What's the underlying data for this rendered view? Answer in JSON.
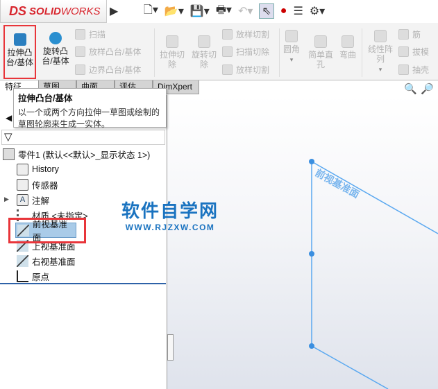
{
  "app": {
    "logo": "SOLIDWORKS",
    "logo_prefix": "DS",
    "logo_bold": "SOLID",
    "logo_light": "WORKS"
  },
  "toolbar": {
    "icons": [
      "new-icon",
      "open-icon",
      "save-icon",
      "print-icon",
      "undo-icon",
      "select-icon",
      "rebuild-icon",
      "file-properties-icon",
      "options-icon"
    ]
  },
  "ribbon": {
    "extrude": "拉伸凸\n台/基体",
    "revolve": "旋转凸\n台/基体",
    "sweep": "扫描",
    "loft": "放样凸台/基体",
    "boundary": "边界凸台/基体",
    "extrude_cut": "拉伸切\n除",
    "revolve_cut": "旋转切\n除",
    "loft_cut": "放样切割",
    "sweep_cut": "扫描切除",
    "boundary_cut": "放样切割",
    "fillet": "圆角",
    "hole": "简单直\n孔",
    "flex": "弯曲",
    "pattern": "线性阵\n列",
    "rib": "筋",
    "draft": "拔模",
    "shell": "抽壳"
  },
  "tabs": [
    "特征",
    "草图",
    "曲面",
    "评估",
    "DimXpert"
  ],
  "tooltip": {
    "title": "拉伸凸台/基体",
    "desc": "以一个或两个方向拉伸一草图或绘制的草图轮廓来生成一实体。"
  },
  "tree": {
    "root": "零件1  (默认<<默认>_显示状态 1>)",
    "items": [
      "History",
      "传感器",
      "注解",
      "材质 <未指定>",
      "前视基准面",
      "上视基准面",
      "右视基准面",
      "原点"
    ]
  },
  "viewport": {
    "plane_label": "前视基准面"
  },
  "watermark": {
    "title": "软件自学网",
    "url": "WWW.RJZXW.COM"
  },
  "colors": {
    "accent": "#d8262e",
    "plane": "#5aa8f0",
    "highlight": "#e8353a"
  }
}
